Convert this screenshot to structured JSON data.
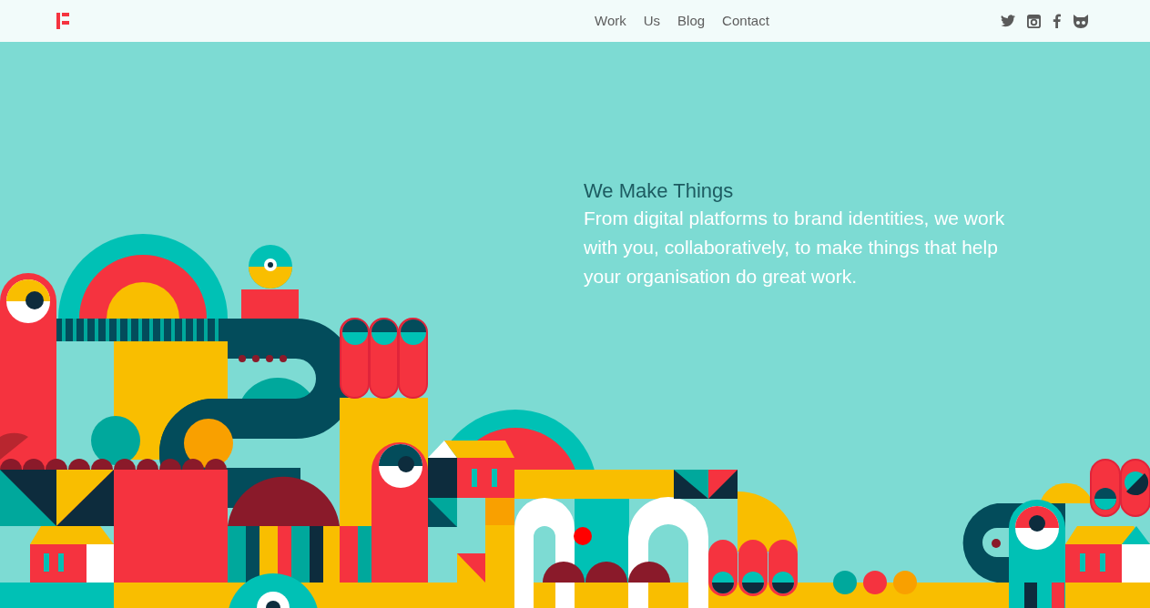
{
  "nav": {
    "links": [
      {
        "label": "Work"
      },
      {
        "label": "Us"
      },
      {
        "label": "Blog"
      },
      {
        "label": "Contact"
      }
    ],
    "social": [
      {
        "kind": "twitter"
      },
      {
        "kind": "instagram"
      },
      {
        "kind": "facebook"
      },
      {
        "kind": "github"
      }
    ]
  },
  "hero": {
    "title": "We Make Things",
    "body": "From digital platforms to brand identities, we work with you, collaboratively, to make things that help your organisation do great work."
  }
}
